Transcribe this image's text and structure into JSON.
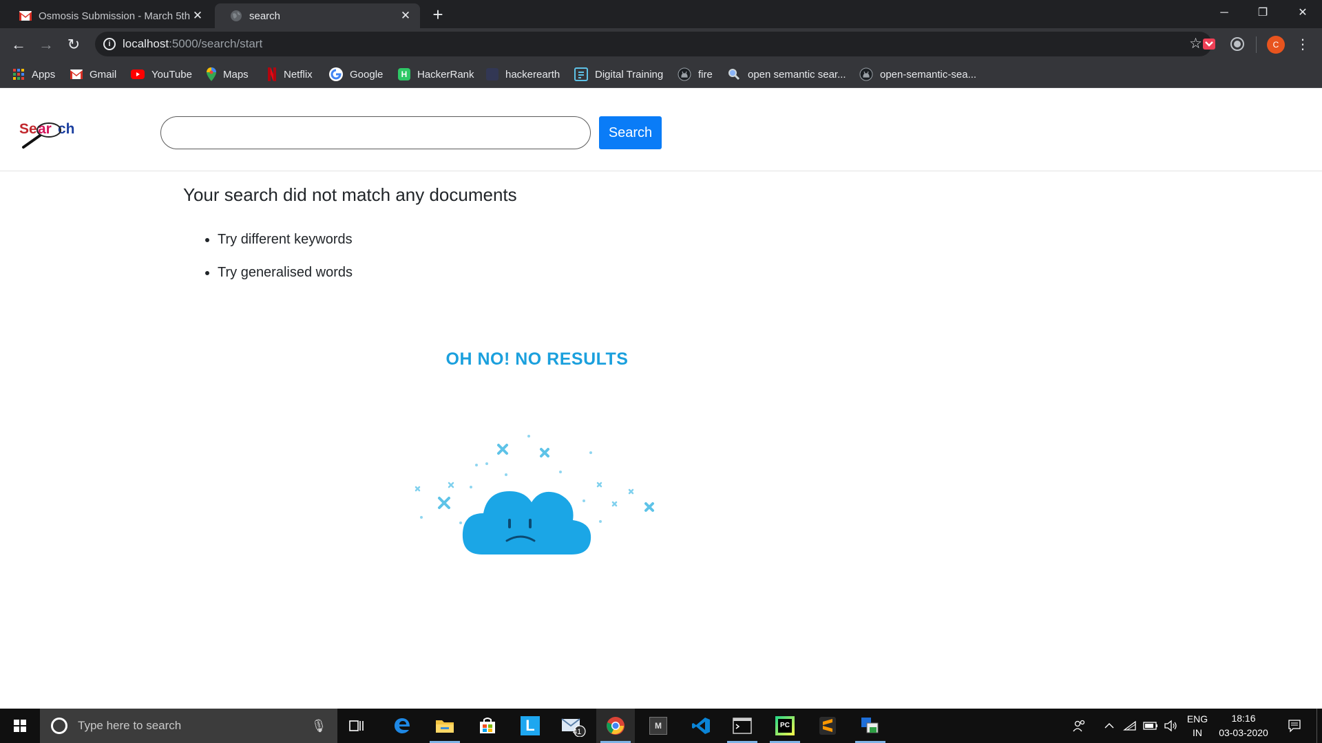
{
  "browser": {
    "tabs": [
      {
        "title": "Osmosis Submission - March 5th",
        "icon": "gmail-icon",
        "active": false
      },
      {
        "title": "search",
        "icon": "globe-icon",
        "active": true
      }
    ],
    "new_tab": "+",
    "window_controls": {
      "minimize": "─",
      "restore": "❐",
      "close": "✕"
    },
    "toolbar": {
      "back": "←",
      "forward": "→",
      "reload": "↻",
      "url_host": "localhost",
      "url_path": ":5000/search/start",
      "star": "☆",
      "profile_initial": "C",
      "menu": "⋮"
    },
    "bookmarks": [
      {
        "label": "Apps",
        "icon": "apps-grid-icon"
      },
      {
        "label": "Gmail",
        "icon": "gmail-icon"
      },
      {
        "label": "YouTube",
        "icon": "youtube-icon"
      },
      {
        "label": "Maps",
        "icon": "maps-pin-icon"
      },
      {
        "label": "Netflix",
        "icon": "netflix-icon"
      },
      {
        "label": "Google",
        "icon": "google-icon"
      },
      {
        "label": "HackerRank",
        "icon": "hackerrank-icon"
      },
      {
        "label": "hackerearth",
        "icon": "hackerearth-icon"
      },
      {
        "label": "Digital Training",
        "icon": "digital-training-icon"
      },
      {
        "label": "fire",
        "icon": "github-icon"
      },
      {
        "label": "open semantic sear...",
        "icon": "magnifier-icon"
      },
      {
        "label": "open-semantic-sea...",
        "icon": "github-icon"
      }
    ]
  },
  "page": {
    "logo_text": "Search",
    "search": {
      "value": "",
      "placeholder": "",
      "button_label": "Search"
    },
    "message": "Your search did not match any documents",
    "suggestions": [
      "Try different keywords",
      "Try generalised words"
    ],
    "illustration_title": "OH NO! NO RESULTS"
  },
  "taskbar": {
    "search_placeholder": "Type here to search",
    "mail_badge": "41",
    "language": "ENG",
    "region": "IN",
    "time": "18:16",
    "date": "03-03-2020"
  },
  "colors": {
    "accent": "#0a7cf7",
    "illustration": "#1ba0dd",
    "chrome_dark": "#202124",
    "chrome_toolbar": "#35363a"
  }
}
